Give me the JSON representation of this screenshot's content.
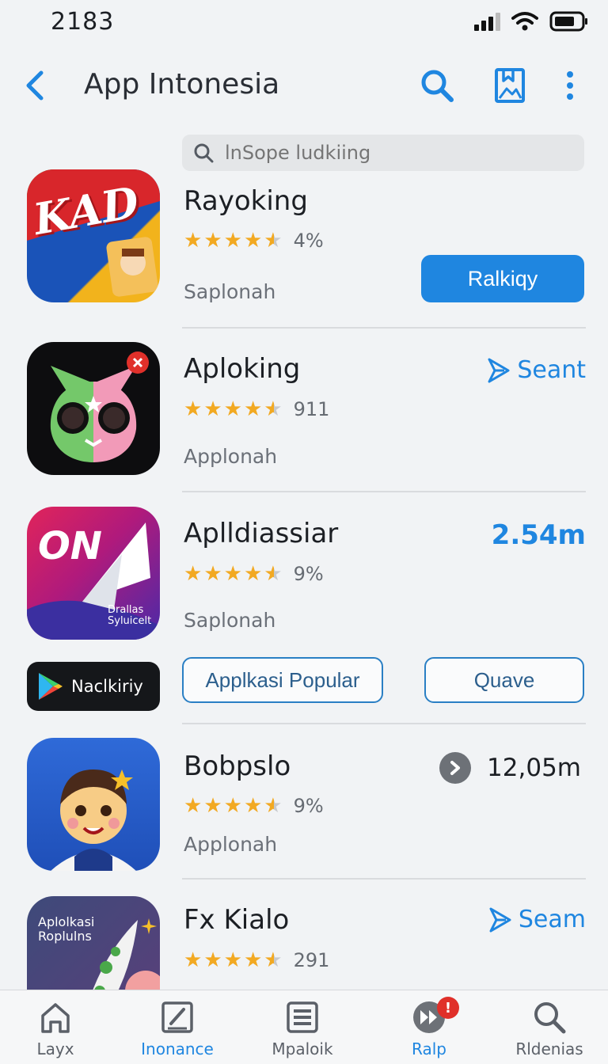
{
  "status_bar": {
    "time": "2183"
  },
  "nav": {
    "title": "App Intonesia"
  },
  "search": {
    "placeholder": "lnSope ludkiing"
  },
  "apps": [
    {
      "name": "Rayoking",
      "rating": 4.5,
      "rating_value": "4%",
      "publisher": "Saplonah",
      "action_label": "Ralkiqy",
      "icon_text": "KAD"
    },
    {
      "name": "Aploking",
      "rating": 4.5,
      "rating_value": "911",
      "publisher": "Applonah",
      "action_label": "Seant"
    },
    {
      "name": "Aplldiassiar",
      "rating": 4.5,
      "rating_value": "9%",
      "publisher": "Saplonah",
      "size": "2.54m",
      "icon_text": "ON",
      "icon_caption": "Drallas Syluicelt"
    },
    {
      "name": "Bobpslo",
      "rating": 4.5,
      "rating_value": "9%",
      "publisher": "Applonah",
      "size": "12,05m"
    },
    {
      "name": "Fx Kialo",
      "rating": 4.5,
      "rating_value": "291",
      "action_label": "Seam",
      "icon_caption": "Aplolkasi Roplulns"
    }
  ],
  "banner": {
    "label": "Naclkiriy",
    "popular_button": "Applkasi Popular",
    "quave_button": "Quave"
  },
  "tabs": [
    {
      "label": "Layx",
      "icon": "home-icon",
      "active": false
    },
    {
      "label": "Inonance",
      "icon": "image-edit-icon",
      "active": true
    },
    {
      "label": "Mpaloik",
      "icon": "list-icon",
      "active": false
    },
    {
      "label": "Ralp",
      "icon": "fast-forward-icon",
      "active": false,
      "badge": "!"
    },
    {
      "label": "Rldenias",
      "icon": "search-icon",
      "active": false
    }
  ],
  "colors": {
    "accent": "#1f86e0",
    "star": "#f2a922",
    "background": "#f1f3f5",
    "badge": "#e0302a"
  }
}
